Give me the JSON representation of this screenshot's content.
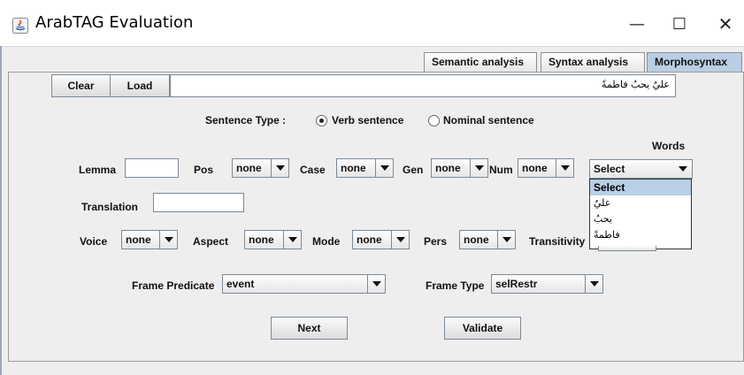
{
  "window": {
    "title": "ArabTAG Evaluation",
    "minimize_glyph": "—",
    "maximize_glyph": "☐",
    "close_glyph": "✕"
  },
  "tabs": [
    {
      "label": "Semantic analysis",
      "active": false
    },
    {
      "label": "Syntax analysis",
      "active": false
    },
    {
      "label": "Morphosyntax",
      "active": true
    }
  ],
  "toolbar": {
    "clear_label": "Clear",
    "load_label": "Load",
    "sentence_value": "عليٌ يحبُ فاطمةً"
  },
  "sentence_type": {
    "label": "Sentence Type :",
    "options": [
      {
        "label": "Verb sentence",
        "checked": true
      },
      {
        "label": "Nominal sentence",
        "checked": false
      }
    ]
  },
  "words": {
    "label": "Words",
    "selected": "Select",
    "options": [
      "Select",
      "عليٌ",
      "يحبُ",
      "فاطمةً"
    ]
  },
  "features_row1": {
    "lemma_label": "Lemma",
    "lemma_value": "",
    "pos_label": "Pos",
    "pos_value": "none",
    "case_label": "Case",
    "case_value": "none",
    "gen_label": "Gen",
    "gen_value": "none",
    "num_label": "Num",
    "num_value": "none"
  },
  "translation": {
    "label": "Translation",
    "value": ""
  },
  "features_row3": {
    "voice_label": "Voice",
    "voice_value": "none",
    "aspect_label": "Aspect",
    "aspect_value": "none",
    "mode_label": "Mode",
    "mode_value": "none",
    "pers_label": "Pers",
    "pers_value": "none",
    "transitivity_label": "Transitivity"
  },
  "frame": {
    "predicate_label": "Frame Predicate",
    "predicate_value": "event",
    "type_label": "Frame Type",
    "type_value": "selRestr"
  },
  "actions": {
    "next_label": "Next",
    "validate_label": "Validate"
  },
  "colors": {
    "selection": "#b8cfe5",
    "panel_bg": "#eeeeee"
  }
}
